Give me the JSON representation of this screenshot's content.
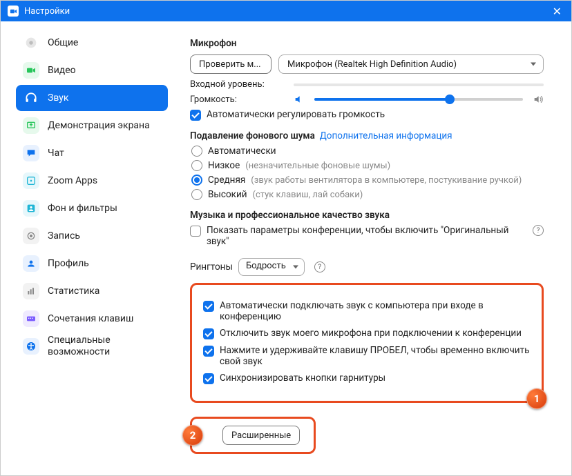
{
  "window": {
    "title": "Настройки"
  },
  "sidebar": {
    "items": [
      {
        "label": "Общие"
      },
      {
        "label": "Видео"
      },
      {
        "label": "Звук"
      },
      {
        "label": "Демонстрация экрана"
      },
      {
        "label": "Чат"
      },
      {
        "label": "Zoom Apps"
      },
      {
        "label": "Фон и фильтры"
      },
      {
        "label": "Запись"
      },
      {
        "label": "Профиль"
      },
      {
        "label": "Статистика"
      },
      {
        "label": "Сочетания клавиш"
      },
      {
        "label": "Специальные возможности"
      }
    ]
  },
  "mic": {
    "heading": "Микрофон",
    "test_btn": "Проверить м...",
    "device": "Микрофон (Realtek High Definition Audio)",
    "input_level_label": "Входной уровень:",
    "volume_label": "Громкость:",
    "auto_adjust": "Автоматически регулировать громкость"
  },
  "noise": {
    "heading": "Подавление фонового шума",
    "info_link": "Дополнительная информация",
    "opts": {
      "auto": "Автоматически",
      "low": "Низкое",
      "low_hint": "(незначительные фоновые шумы)",
      "med": "Средняя",
      "med_hint": "(звук работы вентилятора в компьютере, постукивание ручкой)",
      "high": "Высокий",
      "high_hint": "(стук клавиш, лай собаки)"
    }
  },
  "pro": {
    "heading": "Музыка и профессиональное качество звука",
    "original": "Показать параметры конференции, чтобы включить \"Оригинальный звук\""
  },
  "ringtone": {
    "label": "Рингтоны",
    "value": "Бодрость"
  },
  "opts": {
    "auto_join": "Автоматически подключать звук с компьютера при входе в конференцию",
    "mute_mic": "Отключить звук моего микрофона при подключении к конференции",
    "space_unmute": "Нажмите и удерживайте клавишу ПРОБЕЛ, чтобы временно включить свой звук",
    "sync_headset": "Синхронизировать кнопки гарнитуры"
  },
  "advanced_btn": "Расширенные",
  "badges": {
    "one": "1",
    "two": "2"
  }
}
